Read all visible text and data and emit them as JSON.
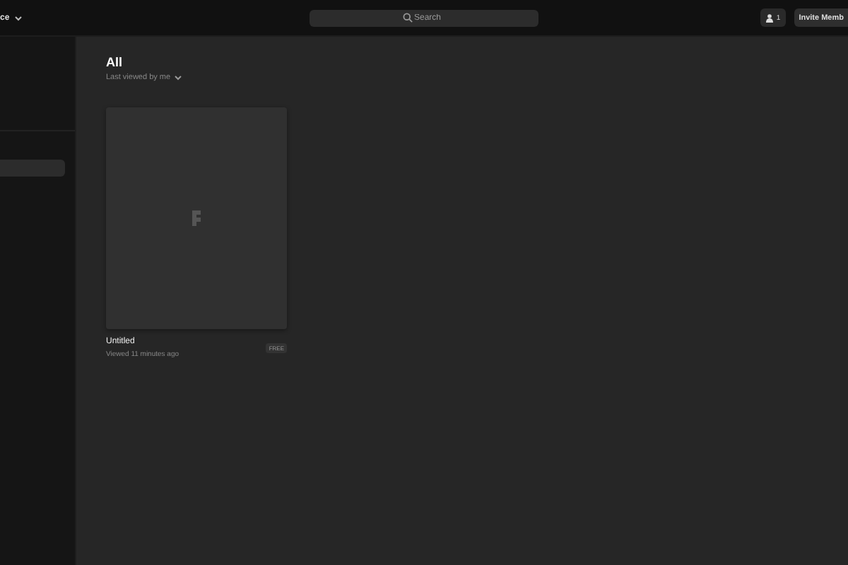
{
  "topbar": {
    "workspace": "ce",
    "search": {
      "placeholder": "Search"
    },
    "members_count": "1",
    "invite_button": "Invite Memb"
  },
  "main": {
    "title": "All",
    "sort": "Last viewed by me"
  },
  "files": [
    {
      "name": "Untitled",
      "meta": "Viewed 11 minutes ago",
      "badge": "FREE"
    }
  ]
}
